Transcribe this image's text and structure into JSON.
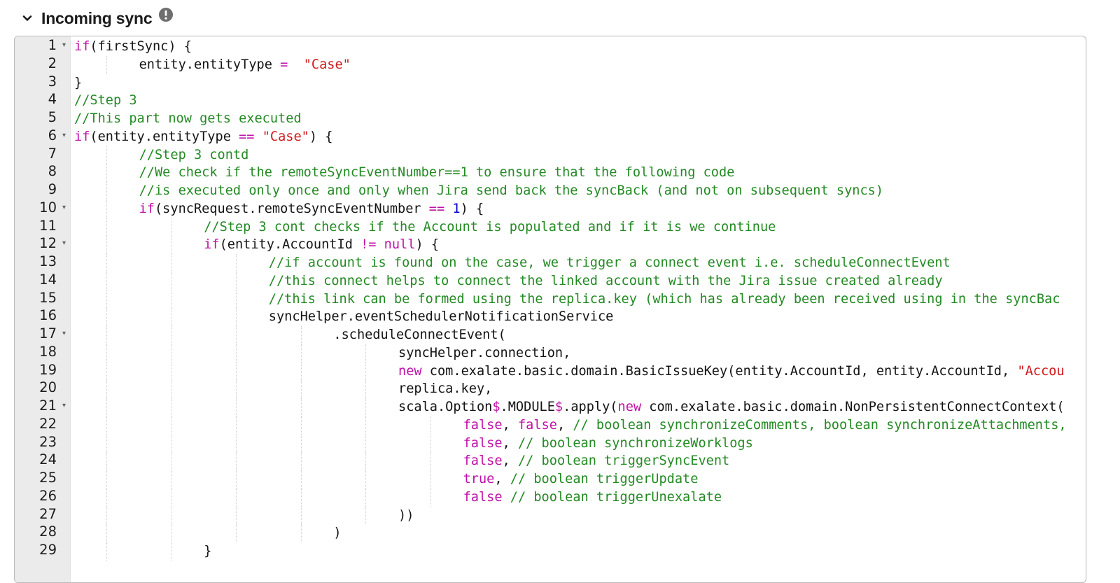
{
  "header": {
    "title": "Incoming sync",
    "collapse_icon": "chevron-down-icon",
    "info_icon": "exclamation-circle-icon"
  },
  "editor": {
    "folded_lines": [
      1,
      6,
      10,
      12,
      17,
      21
    ],
    "lines": [
      {
        "n": "1",
        "indent": 0,
        "tokens": [
          [
            "kw",
            "if"
          ],
          [
            "",
            "(firstSync) {"
          ]
        ]
      },
      {
        "n": "2",
        "indent": 1,
        "tokens": [
          [
            "",
            "entity.entityType "
          ],
          [
            "op",
            "="
          ],
          [
            "",
            "  "
          ],
          [
            "st",
            "\"Case\""
          ]
        ]
      },
      {
        "n": "3",
        "indent": 0,
        "tokens": [
          [
            "",
            "}"
          ]
        ]
      },
      {
        "n": "4",
        "indent": 0,
        "tokens": [
          [
            "cm",
            "//Step 3"
          ]
        ]
      },
      {
        "n": "5",
        "indent": 0,
        "tokens": [
          [
            "cm",
            "//This part now gets executed"
          ]
        ]
      },
      {
        "n": "6",
        "indent": 0,
        "tokens": [
          [
            "kw",
            "if"
          ],
          [
            "",
            "(entity.entityType "
          ],
          [
            "op",
            "=="
          ],
          [
            "",
            " "
          ],
          [
            "st",
            "\"Case\""
          ],
          [
            "",
            ") {"
          ]
        ]
      },
      {
        "n": "7",
        "indent": 1,
        "tokens": [
          [
            "cm",
            "//Step 3 contd"
          ]
        ]
      },
      {
        "n": "8",
        "indent": 1,
        "tokens": [
          [
            "cm",
            "//We check if the remoteSyncEventNumber==1 to ensure that the following code"
          ]
        ]
      },
      {
        "n": "9",
        "indent": 1,
        "tokens": [
          [
            "cm",
            "//is executed only once and only when Jira send back the syncBack (and not on subsequent syncs)"
          ]
        ]
      },
      {
        "n": "10",
        "indent": 1,
        "tokens": [
          [
            "kw",
            "if"
          ],
          [
            "",
            "(syncRequest.remoteSyncEventNumber "
          ],
          [
            "op",
            "=="
          ],
          [
            "",
            " "
          ],
          [
            "nm",
            "1"
          ],
          [
            "",
            ") {"
          ]
        ]
      },
      {
        "n": "11",
        "indent": 2,
        "tokens": [
          [
            "cm",
            "//Step 3 cont checks if the Account is populated and if it is we continue"
          ]
        ]
      },
      {
        "n": "12",
        "indent": 2,
        "tokens": [
          [
            "kw",
            "if"
          ],
          [
            "",
            "(entity.AccountId "
          ],
          [
            "op",
            "!="
          ],
          [
            "",
            " "
          ],
          [
            "lit",
            "null"
          ],
          [
            "",
            ") {"
          ]
        ]
      },
      {
        "n": "13",
        "indent": 3,
        "tokens": [
          [
            "cm",
            "//if account is found on the case, we trigger a connect event i.e. scheduleConnectEvent"
          ]
        ]
      },
      {
        "n": "14",
        "indent": 3,
        "tokens": [
          [
            "cm",
            "//this connect helps to connect the linked account with the Jira issue created already"
          ]
        ]
      },
      {
        "n": "15",
        "indent": 3,
        "tokens": [
          [
            "cm",
            "//this link can be formed using the replica.key (which has already been received using in the syncBac"
          ]
        ]
      },
      {
        "n": "16",
        "indent": 3,
        "tokens": [
          [
            "",
            "syncHelper.eventSchedulerNotificationService"
          ]
        ]
      },
      {
        "n": "17",
        "indent": 4,
        "tokens": [
          [
            "",
            ".scheduleConnectEvent("
          ]
        ]
      },
      {
        "n": "18",
        "indent": 5,
        "tokens": [
          [
            "",
            "syncHelper.connection,"
          ]
        ]
      },
      {
        "n": "19",
        "indent": 5,
        "tokens": [
          [
            "kw",
            "new"
          ],
          [
            "",
            " com.exalate.basic.domain.BasicIssueKey(entity.AccountId, entity.AccountId, "
          ],
          [
            "st",
            "\"Accou"
          ]
        ]
      },
      {
        "n": "20",
        "indent": 5,
        "tokens": [
          [
            "",
            "replica.key,"
          ]
        ]
      },
      {
        "n": "21",
        "indent": 5,
        "tokens": [
          [
            "",
            "scala.Option"
          ],
          [
            "op",
            "$"
          ],
          [
            "",
            ".MODULE"
          ],
          [
            "op",
            "$"
          ],
          [
            "",
            ".apply("
          ],
          [
            "kw",
            "new"
          ],
          [
            "",
            " com.exalate.basic.domain.NonPersistentConnectContext("
          ]
        ]
      },
      {
        "n": "22",
        "indent": 6,
        "tokens": [
          [
            "lit",
            "false"
          ],
          [
            "",
            ", "
          ],
          [
            "lit",
            "false"
          ],
          [
            "",
            ", "
          ],
          [
            "cm",
            "// boolean synchronizeComments, boolean synchronizeAttachments,"
          ]
        ]
      },
      {
        "n": "23",
        "indent": 6,
        "tokens": [
          [
            "lit",
            "false"
          ],
          [
            "",
            ", "
          ],
          [
            "cm",
            "// boolean synchronizeWorklogs"
          ]
        ]
      },
      {
        "n": "24",
        "indent": 6,
        "tokens": [
          [
            "lit",
            "false"
          ],
          [
            "",
            ", "
          ],
          [
            "cm",
            "// boolean triggerSyncEvent"
          ]
        ]
      },
      {
        "n": "25",
        "indent": 6,
        "tokens": [
          [
            "lit",
            "true"
          ],
          [
            "",
            ", "
          ],
          [
            "cm",
            "// boolean triggerUpdate"
          ]
        ]
      },
      {
        "n": "26",
        "indent": 6,
        "tokens": [
          [
            "lit",
            "false"
          ],
          [
            "",
            " "
          ],
          [
            "cm",
            "// boolean triggerUnexalate"
          ]
        ]
      },
      {
        "n": "27",
        "indent": 5,
        "tokens": [
          [
            "",
            "))"
          ]
        ]
      },
      {
        "n": "28",
        "indent": 4,
        "tokens": [
          [
            "",
            ")"
          ]
        ]
      },
      {
        "n": "29",
        "indent": 2,
        "tokens": [
          [
            "",
            "}"
          ]
        ]
      }
    ]
  }
}
